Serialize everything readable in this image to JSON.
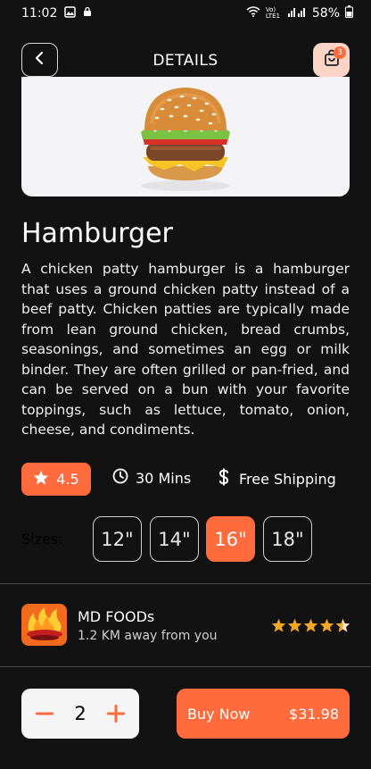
{
  "status": {
    "time": "11:02",
    "battery": "58%",
    "network": "Vo) LTE1"
  },
  "header": {
    "title": "DETAILS",
    "cart_count": "3"
  },
  "product": {
    "name": "Hamburger",
    "description": "A chicken patty hamburger is a hamburger that uses a ground chicken patty instead of a beef patty. Chicken patties are typically made from lean ground chicken, bread crumbs, seasonings, and sometimes an egg or milk binder. They are often grilled or pan-fried, and can be served on a bun with your favorite toppings, such as lettuce, tomato, onion, cheese, and condiments.",
    "rating": "4.5",
    "time": "30 Mins",
    "shipping": "Free Shipping"
  },
  "sizes": {
    "label": "Sizes:",
    "options": [
      "12\"",
      "14\"",
      "16\"",
      "18\""
    ],
    "selected": "16\""
  },
  "store": {
    "name": "MD FOODs",
    "distance": "1.2 KM away from you",
    "stars": 4.5
  },
  "order": {
    "quantity": "2",
    "buy_label": "Buy Now",
    "price": "$31.98"
  },
  "colors": {
    "accent": "#ff6b3d",
    "background": "#121212",
    "cart_bg": "#fbd4c6"
  }
}
